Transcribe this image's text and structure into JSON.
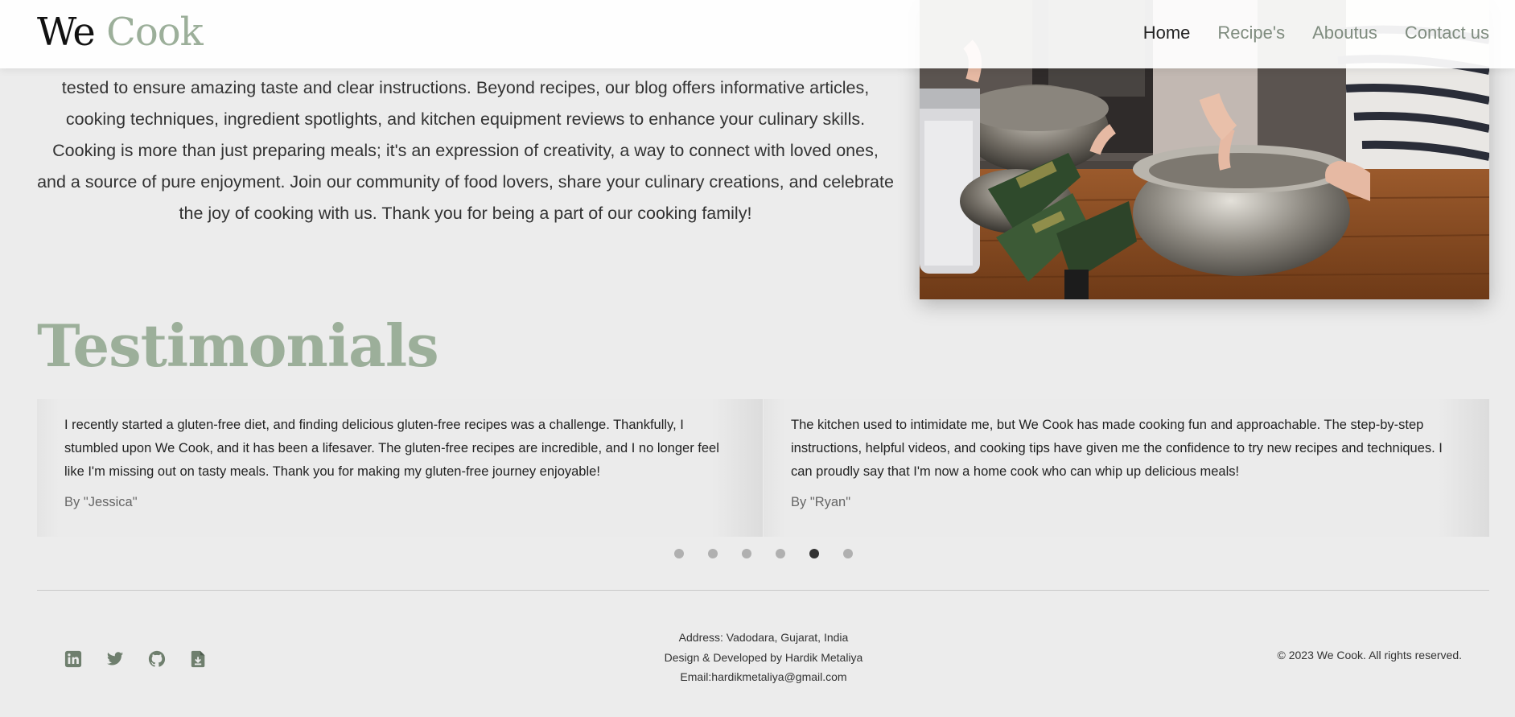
{
  "brand": {
    "first": "We",
    "second": "Cook"
  },
  "nav": {
    "items": [
      {
        "label": "Home",
        "active": true
      },
      {
        "label": "Recipe's",
        "active": false
      },
      {
        "label": "Aboutus",
        "active": false
      },
      {
        "label": "Contact us",
        "active": false
      }
    ]
  },
  "about": {
    "text": "tested to ensure amazing taste and clear instructions. Beyond recipes, our blog offers informative articles, cooking techniques, ingredient spotlights, and kitchen equipment reviews to enhance your culinary skills. Cooking is more than just preparing meals; it's an expression of creativity, a way to connect with loved ones, and a source of pure enjoyment. Join our community of food lovers, share your culinary creations, and celebrate the joy of cooking with us. Thank you for being a part of our cooking family!"
  },
  "testimonials": {
    "title": "Testimonials",
    "cards": [
      {
        "quote": "I recently started a gluten-free diet, and finding delicious gluten-free recipes was a challenge. Thankfully, I stumbled upon We Cook, and it has been a lifesaver. The gluten-free recipes are incredible, and I no longer feel like I'm missing out on tasty meals. Thank you for making my gluten-free journey enjoyable!",
        "author": "By \"Jessica\""
      },
      {
        "quote": "The kitchen used to intimidate me, but We Cook has made cooking fun and approachable. The step-by-step instructions, helpful videos, and cooking tips have given me the confidence to try new recipes and techniques. I can proudly say that I'm now a home cook who can whip up delicious meals!",
        "author": "By \"Ryan\""
      }
    ],
    "dots_count": 6,
    "active_dot": 5
  },
  "footer": {
    "socials": [
      "linkedin-icon",
      "twitter-icon",
      "github-icon",
      "resume-download-icon"
    ],
    "address": "Address: Vadodara, Gujarat, India",
    "credit": "Design & Developed by Hardik Metaliya",
    "email": "Email:hardikmetaliya@gmail.com",
    "copyright": "© 2023 We Cook. All rights reserved."
  },
  "colors": {
    "accent": "#9caf9a",
    "nav_inactive": "#7f8c7f",
    "background": "#ececec",
    "social_icon": "#6f7f6e"
  }
}
